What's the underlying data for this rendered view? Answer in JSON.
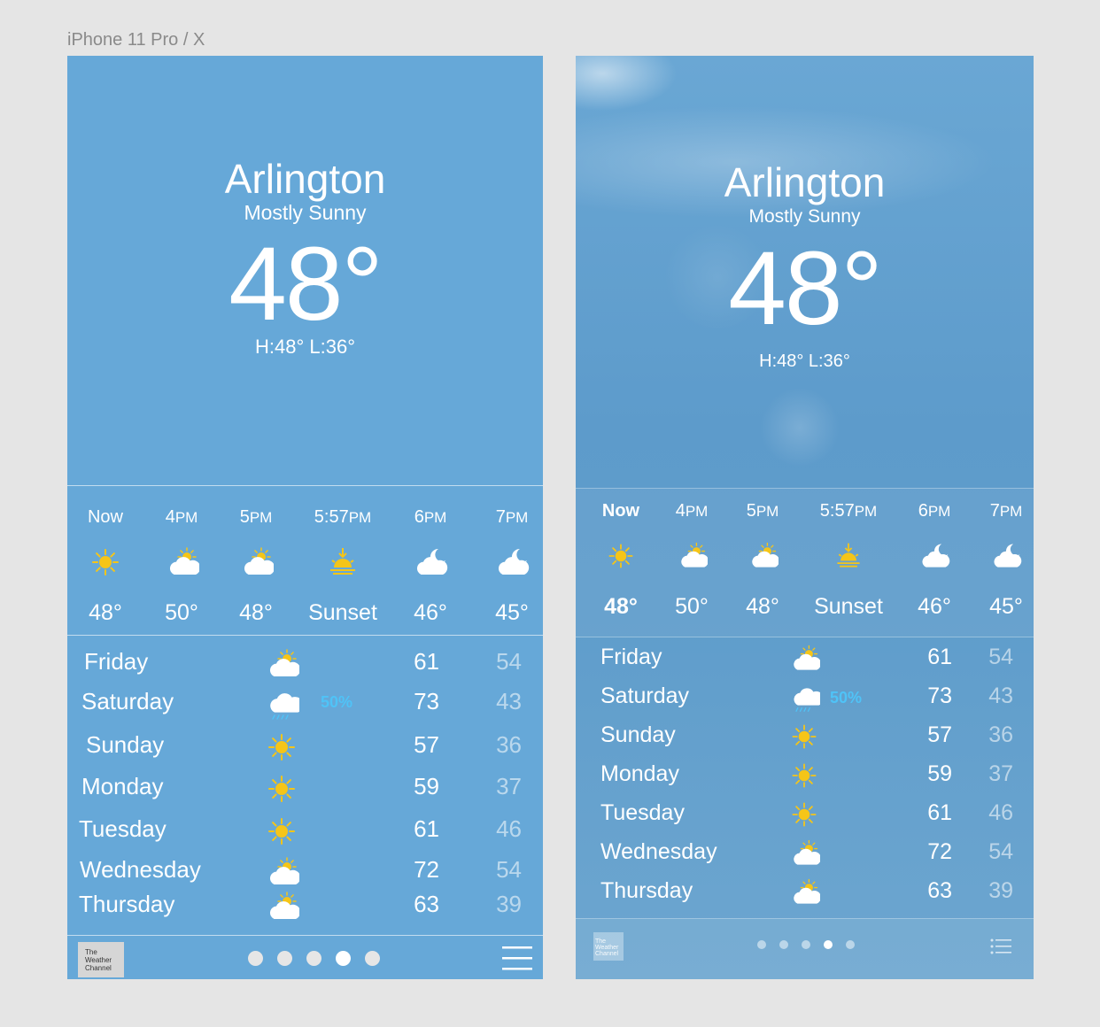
{
  "frame_label": "iPhone 11 Pro / X",
  "location": {
    "city": "Arlington",
    "condition": "Mostly Sunny",
    "temperature": "48°",
    "hi_lo": "H:48° L:36°"
  },
  "hourly": [
    {
      "time": "Now",
      "suffix": "",
      "icon": "sun-icon",
      "temp": "48°"
    },
    {
      "time": "4",
      "suffix": "PM",
      "icon": "partly-cloudy-icon",
      "temp": "50°"
    },
    {
      "time": "5",
      "suffix": "PM",
      "icon": "partly-cloudy-icon",
      "temp": "48°"
    },
    {
      "time": "5:57",
      "suffix": "PM",
      "icon": "sunset-icon",
      "temp": "Sunset"
    },
    {
      "time": "6",
      "suffix": "PM",
      "icon": "cloudy-night-icon",
      "temp": "46°"
    },
    {
      "time": "7",
      "suffix": "PM",
      "icon": "cloudy-night-icon",
      "temp": "45°"
    }
  ],
  "daily": [
    {
      "day": "Friday",
      "icon": "partly-cloudy-icon",
      "pop": "",
      "hi": "61",
      "lo": "54"
    },
    {
      "day": "Saturday",
      "icon": "rain-cloud-icon",
      "pop": "50%",
      "hi": "73",
      "lo": "43"
    },
    {
      "day": "Sunday",
      "icon": "sun-icon",
      "pop": "",
      "hi": "57",
      "lo": "36"
    },
    {
      "day": "Monday",
      "icon": "sun-icon",
      "pop": "",
      "hi": "59",
      "lo": "37"
    },
    {
      "day": "Tuesday",
      "icon": "sun-icon",
      "pop": "",
      "hi": "61",
      "lo": "46"
    },
    {
      "day": "Wednesday",
      "icon": "partly-cloudy-icon",
      "pop": "",
      "hi": "72",
      "lo": "54"
    },
    {
      "day": "Thursday",
      "icon": "partly-cloudy-icon",
      "pop": "",
      "hi": "63",
      "lo": "39"
    }
  ],
  "footer": {
    "logo_text": "The Weather Channel",
    "page_count": 5,
    "active_page": 4
  },
  "colors": {
    "sun": "#f5c518",
    "precip": "#4fc3f7",
    "flat_background": "#66a8d8"
  }
}
